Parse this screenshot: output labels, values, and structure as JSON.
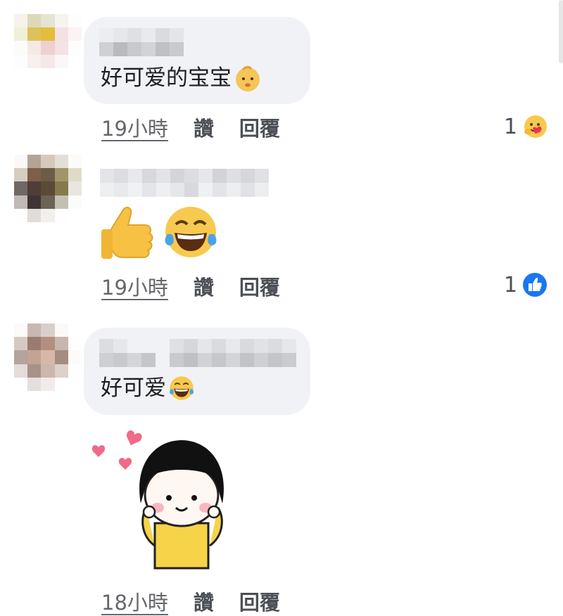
{
  "comments": [
    {
      "text": "好可爱的宝宝",
      "emoji": "baby-face-emoji",
      "time": "19小時",
      "like_label": "讚",
      "reply_label": "回覆",
      "reaction_count": "1",
      "reaction_icon": "care-reaction-icon"
    },
    {
      "emoji": [
        "thumbs-up-emoji",
        "tears-of-joy-emoji"
      ],
      "time": "19小時",
      "like_label": "讚",
      "reply_label": "回覆",
      "reaction_count": "1",
      "reaction_icon": "like-reaction-icon"
    },
    {
      "text": "好可爱",
      "emoji": "tears-of-joy-emoji",
      "sticker": "girl-with-hearts-sticker",
      "time": "18小時",
      "like_label": "讚",
      "reply_label": "回覆"
    }
  ],
  "colors": {
    "bubble": "#f0f2f5",
    "meta_text": "#65676b",
    "like_blue": "#1877f2",
    "sticker_shirt": "#f7d34a",
    "heart": "#f06a8a"
  }
}
